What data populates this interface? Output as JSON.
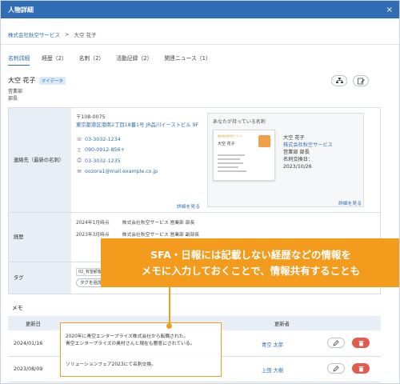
{
  "window": {
    "title": "人物詳細",
    "close_label": "×"
  },
  "breadcrumb": {
    "company": "株式会社秋空サービス",
    "separator": ">",
    "person": "大空 花子"
  },
  "tabs": [
    "名刺詳細",
    "経歴（2）",
    "名刺（2）",
    "活動記録（2）",
    "関連ニュース（1）"
  ],
  "person": {
    "name": "大空 花子",
    "badge": "マイデータ",
    "dept": "営業部",
    "title": "部長"
  },
  "contact": {
    "label": "連絡先（最新の名刺）",
    "zip": "〒108-0075",
    "address": "東京都港区港南2丁目18番1号 JR品川イーストビル 9F",
    "phone1": "03-3032-1234",
    "mobile": "090-0912-856+",
    "fax": "03-3032-1235",
    "email": "oozora1@mail.example.co.jp",
    "detail_link": "詳細を見る"
  },
  "card": {
    "header": "あなたが持っている名刺",
    "name": "大空 花子",
    "company": "株式会社秋空サービス",
    "position": "営業部 部長",
    "exchanged": "名刺交換日：2023/10/26",
    "detail_link": "詳細を見る"
  },
  "career": {
    "label": "経歴",
    "items": [
      {
        "date": "2024年1月時点",
        "text": "株式会社秋空サービス 営業部 部長"
      },
      {
        "date": "2023年3月時点",
        "text": "株式会社秋空サービス 営業部 副部長"
      }
    ]
  },
  "tag": {
    "label": "タグ",
    "input_value": "02_有望顧客",
    "button_label": "タグを追加"
  },
  "banner": {
    "line1": "SFA・日報には記載しない経歴などの情報を",
    "line2": "メモに入力しておくことで、情報共有することも"
  },
  "memo": {
    "title": "メモ",
    "col_date": "更新日",
    "col_author": "更新者",
    "rows": [
      {
        "date": "2024/01/16",
        "text1": "2020年に青空エンタープライズ株式会社から転職された。",
        "text2": "青空エンタープライズの奥村さんと現在も懇意にされている。",
        "author": "青空 太郎"
      },
      {
        "date": "2023/08/09",
        "text1": "ソリューションフェア2023にて名刺交換。",
        "text2": "",
        "author": "上田 大樹"
      }
    ]
  },
  "colors": {
    "primary": "#2f6db5",
    "accent": "#f29b1d",
    "delete": "#e25b4f"
  }
}
